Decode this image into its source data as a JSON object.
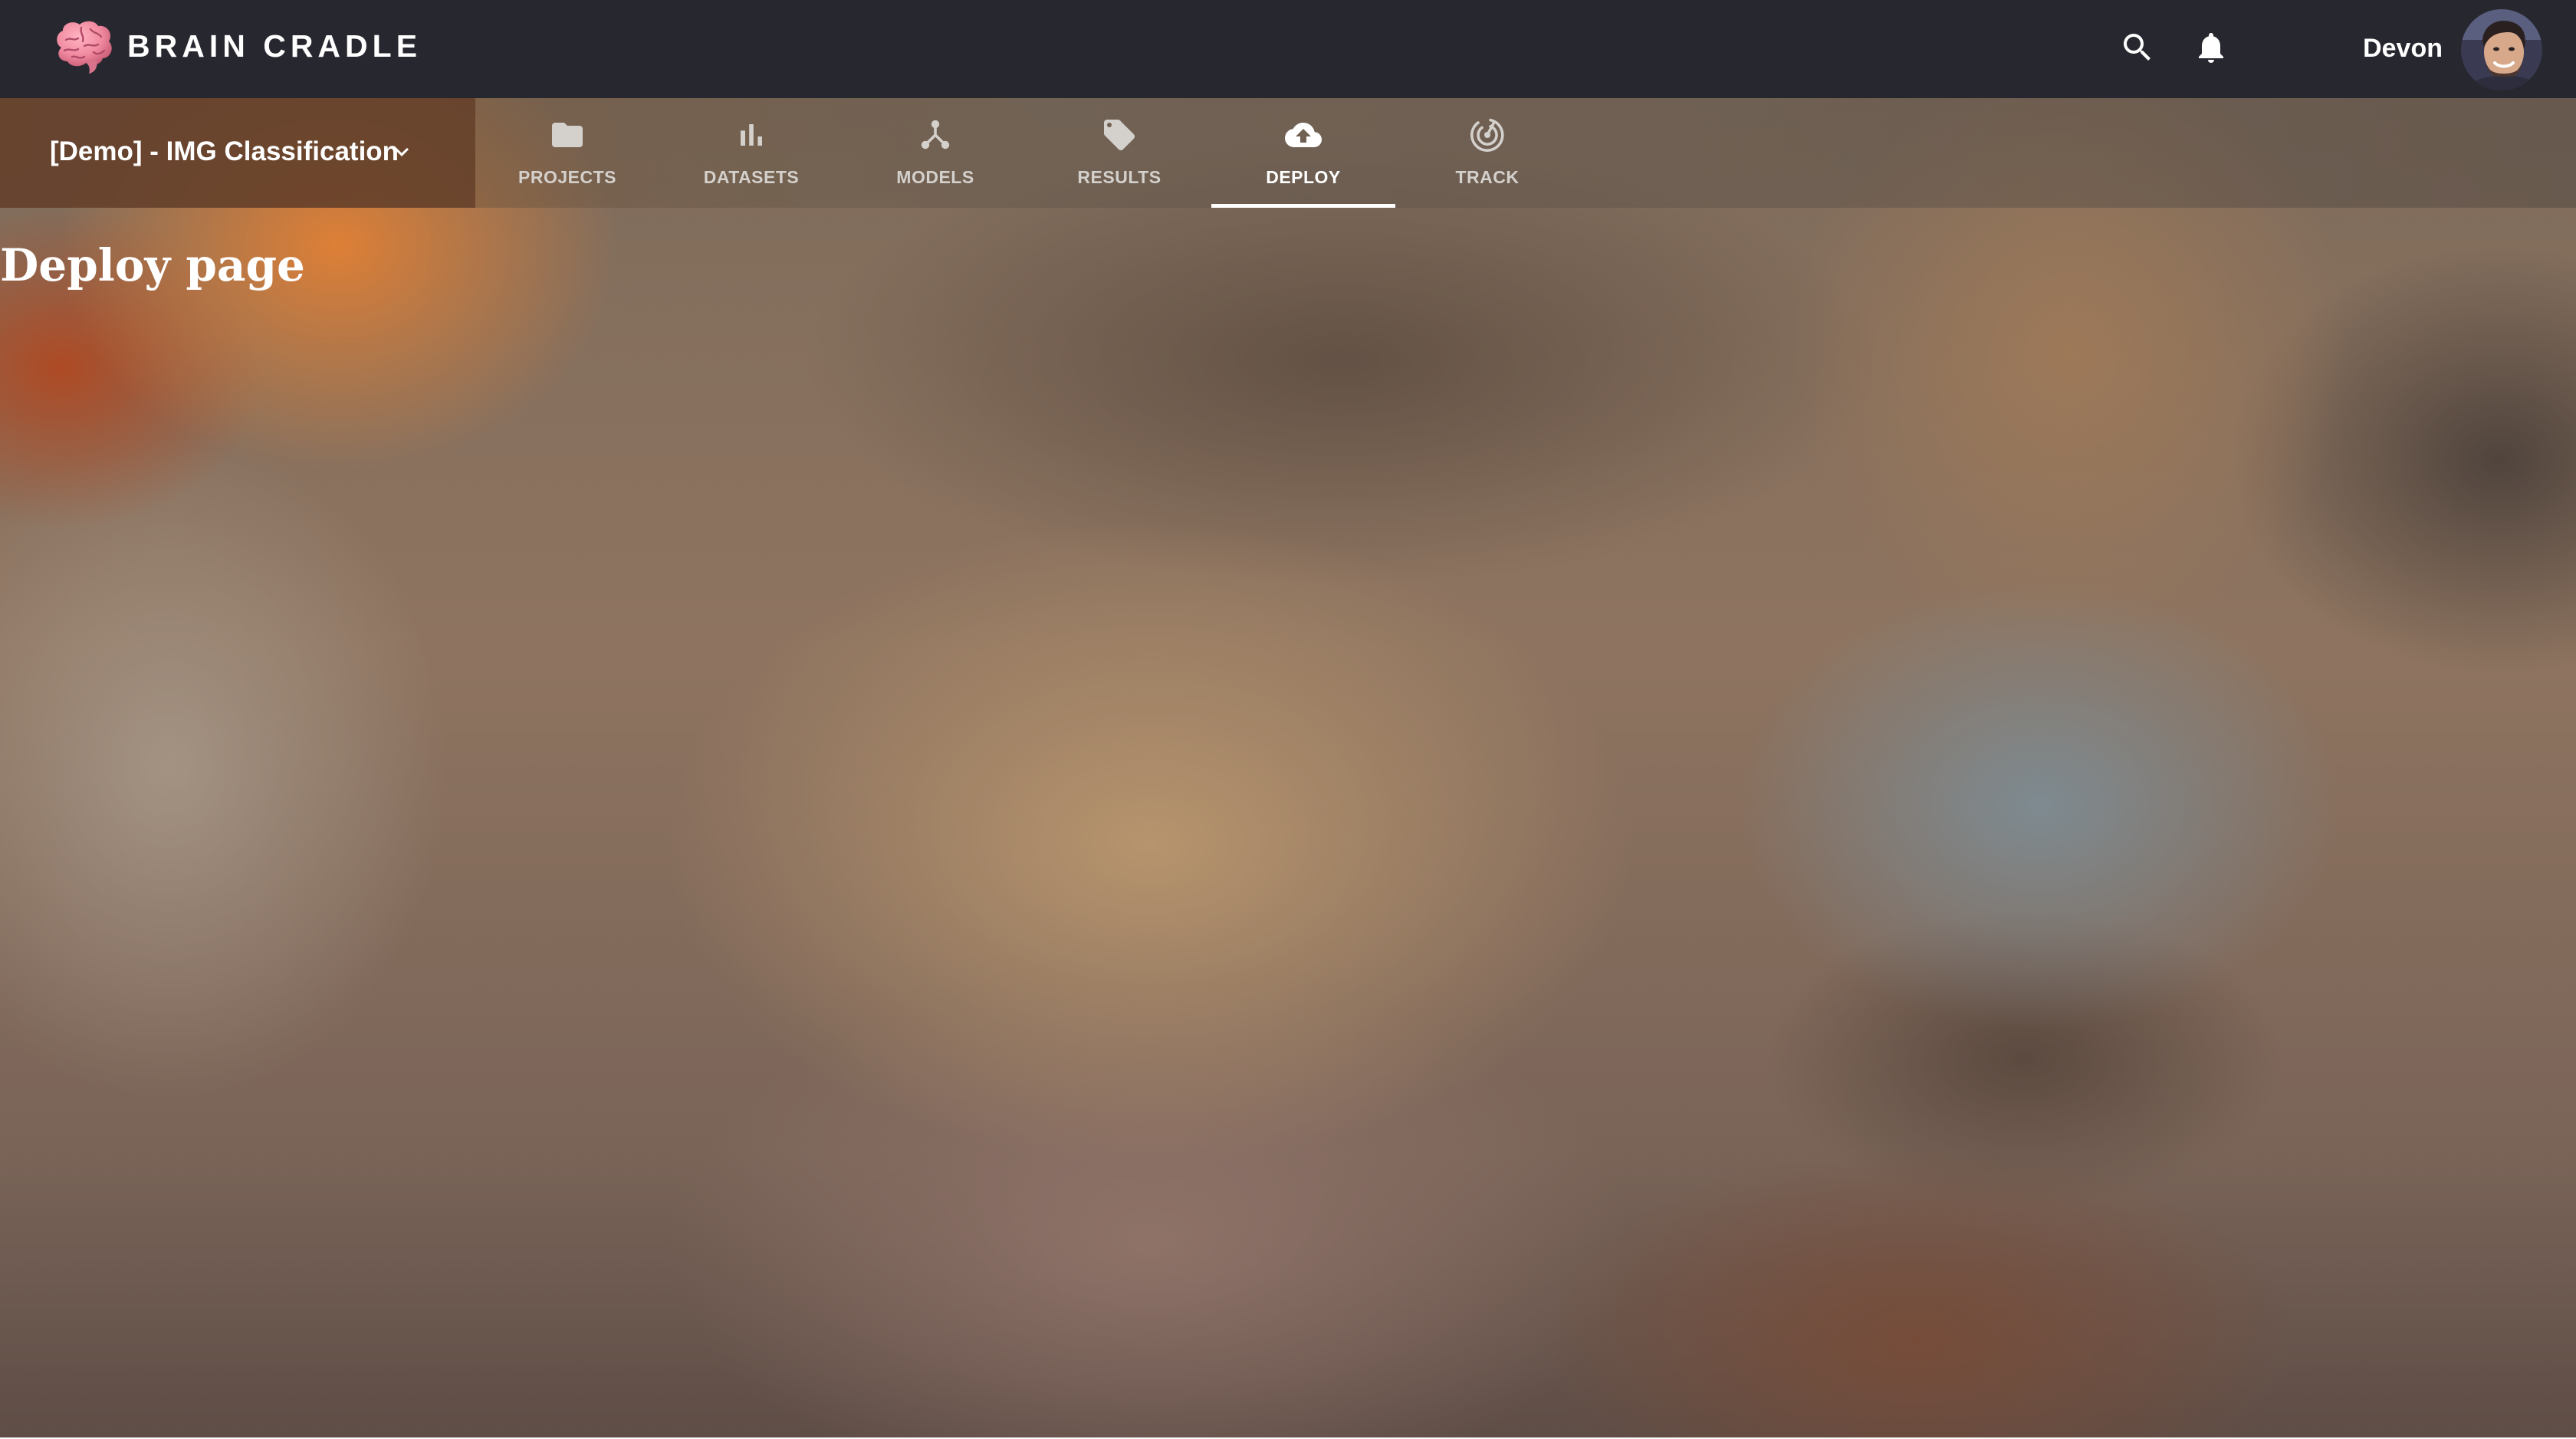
{
  "app": {
    "brand_name": "BRAIN CRADLE",
    "brand_icon": "brain-icon"
  },
  "header": {
    "search_icon": "search-icon",
    "notifications_icon": "bell-icon",
    "user_name": "Devon"
  },
  "project_selector": {
    "label": "[Demo] - IMG Classification",
    "icon": "chevron-down-icon"
  },
  "tabs": [
    {
      "label": "PROJECTS",
      "icon": "folder-icon",
      "active": false
    },
    {
      "label": "DATASETS",
      "icon": "bar-chart-icon",
      "active": false
    },
    {
      "label": "MODELS",
      "icon": "network-icon",
      "active": false
    },
    {
      "label": "RESULTS",
      "icon": "tag-icon",
      "active": false
    },
    {
      "label": "DEPLOY",
      "icon": "cloud-upload-icon",
      "active": true
    },
    {
      "label": "TRACK",
      "icon": "radar-icon",
      "active": false
    }
  ],
  "main": {
    "title": "Deploy page"
  },
  "colors": {
    "appbar": "#27272f",
    "active_indicator": "#ffffff",
    "tab_text": "#d4d0cc",
    "brain": "#f08aa0"
  }
}
